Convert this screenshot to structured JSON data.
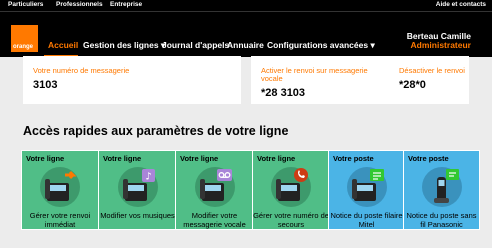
{
  "topbar": {
    "links": [
      "Particuliers",
      "Professionnels",
      "Entreprise"
    ],
    "right": "Aide et contacts"
  },
  "header": {
    "logo": "orange",
    "nav": [
      "Accueil",
      "Gestion des lignes ▾",
      "Journal d'appels",
      "Annuaire",
      "Configurations avancées ▾"
    ],
    "user_name": "Berteau Camille",
    "user_role": "Administrateur"
  },
  "cards": {
    "voicemail_label": "Votre numéro de messagerie",
    "voicemail_value": "3103",
    "activate_label": "Activer le renvoi sur messagerie vocale",
    "activate_value": "*28 3103",
    "deactivate_label": "Désactiver le renvoi",
    "deactivate_value": "*28*0"
  },
  "quick_access": {
    "title": "Accès rapides aux paramètres de votre ligne",
    "tiles": [
      {
        "head": "Votre ligne",
        "caption": "Gérer votre renvoi immédiat",
        "icon": "desk-phone-forward-icon",
        "color": "green"
      },
      {
        "head": "Votre ligne",
        "caption": "Modifier vos musiques",
        "icon": "desk-phone-music-icon",
        "color": "green"
      },
      {
        "head": "Votre ligne",
        "caption": "Modifier votre messagerie vocale",
        "icon": "desk-phone-voicemail-icon",
        "color": "green"
      },
      {
        "head": "Votre ligne",
        "caption": "Gérer votre numéro de secours",
        "icon": "desk-phone-emergency-icon",
        "color": "green"
      },
      {
        "head": "Votre poste",
        "caption": "Notice du poste filaire Mitel",
        "icon": "desk-phone-notice-icon",
        "color": "blue"
      },
      {
        "head": "Votre poste",
        "caption": "Notice du poste sans fil Panasonic",
        "icon": "cordless-phone-notice-icon",
        "color": "blue"
      }
    ]
  },
  "colors": {
    "brand": "#ff7900",
    "green": "#50be87",
    "blue": "#4bb4e6"
  }
}
